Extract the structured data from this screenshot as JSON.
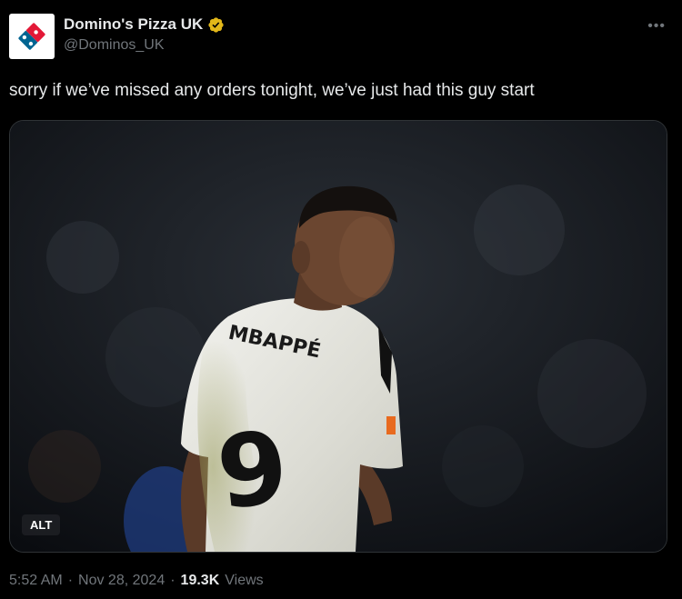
{
  "author": {
    "display_name": "Domino's Pizza UK",
    "handle": "@Dominos_UK",
    "verified_color": "#e2b719",
    "brand_colors": {
      "red": "#e31837",
      "blue": "#006491"
    }
  },
  "tweet": {
    "text": "sorry if we’ve missed any orders tonight, we’ve just had this guy start"
  },
  "media": {
    "alt_badge": "ALT",
    "jersey_name": "MBAPPÉ",
    "jersey_number": "9"
  },
  "meta": {
    "time": "5:52 AM",
    "sep1": "·",
    "date": "Nov 28, 2024",
    "sep2": "·",
    "views_count": "19.3K",
    "views_label": "Views"
  },
  "icons": {
    "more": "more-icon",
    "verified": "verified-badge-icon",
    "logo": "dominos-logo-icon"
  }
}
